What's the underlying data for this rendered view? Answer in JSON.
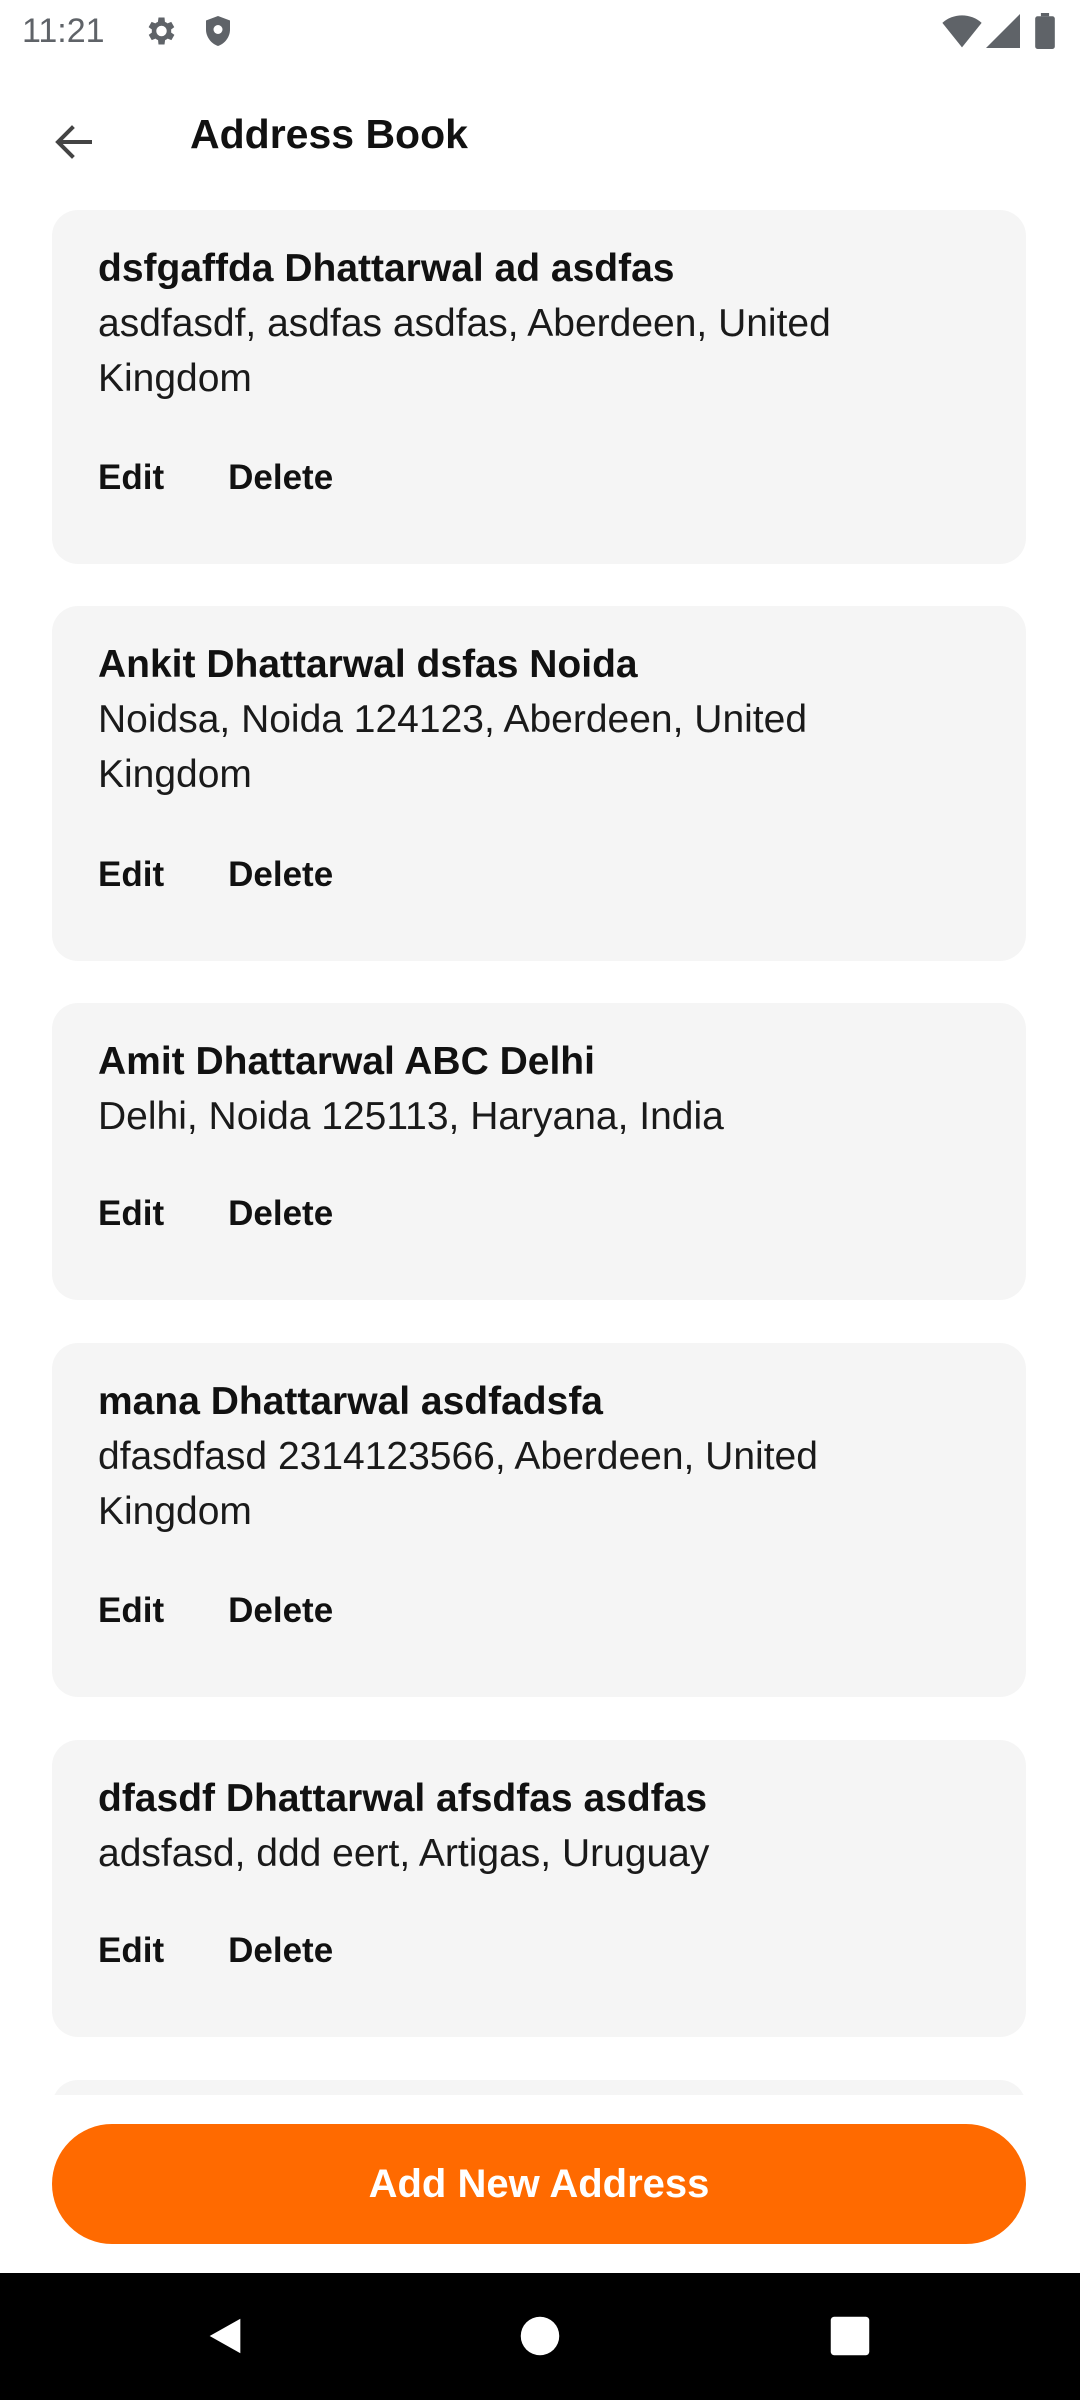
{
  "status_bar": {
    "time": "11:21"
  },
  "header": {
    "title": "Address Book"
  },
  "addresses": [
    {
      "name": "dsfgaffda Dhattarwal ad asdfas",
      "address": "asdfasdf, asdfas asdfas, Aberdeen, United Kingdom",
      "edit_label": "Edit",
      "delete_label": "Delete"
    },
    {
      "name": "Ankit Dhattarwal dsfas Noida",
      "address": "Noidsa, Noida 124123, Aberdeen, United Kingdom",
      "edit_label": "Edit",
      "delete_label": "Delete"
    },
    {
      "name": "Amit Dhattarwal ABC Delhi",
      "address": "Delhi, Noida 125113, Haryana, India",
      "edit_label": "Edit",
      "delete_label": "Delete"
    },
    {
      "name": "mana Dhattarwal asdfadsfa",
      "address": "dfasdfasd 2314123566, Aberdeen, United Kingdom",
      "edit_label": "Edit",
      "delete_label": "Delete"
    },
    {
      "name": "dfasdf Dhattarwal afsdfas asdfas",
      "address": "adsfasd, ddd eert, Artigas, Uruguay",
      "edit_label": "Edit",
      "delete_label": "Delete"
    }
  ],
  "footer": {
    "add_label": "Add New Address"
  },
  "colors": {
    "accent": "#ff6a00",
    "card_bg": "#f5f5f5"
  },
  "icons": {
    "back": "arrow-left-icon",
    "settings": "gear-icon",
    "shield": "shield-icon",
    "wifi": "wifi-icon",
    "signal": "cell-signal-icon",
    "battery": "battery-icon",
    "nav_back": "triangle-back-icon",
    "nav_home": "circle-home-icon",
    "nav_recents": "square-recents-icon"
  }
}
